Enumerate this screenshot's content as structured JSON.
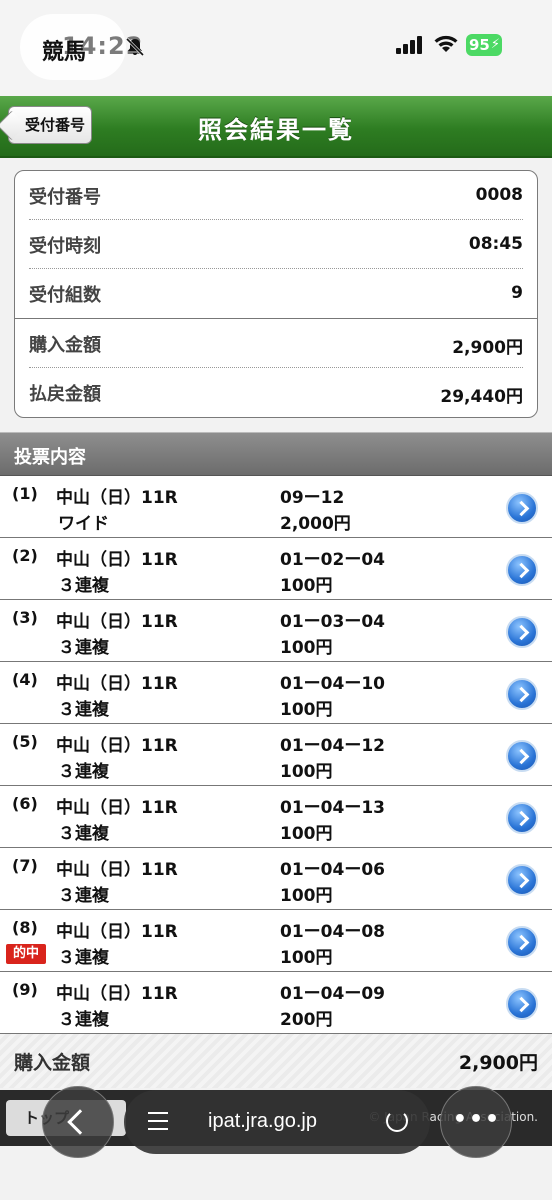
{
  "status": {
    "app_label": "競馬",
    "time": "14:22",
    "battery": "95"
  },
  "header": {
    "back_label": "受付番号",
    "title": "照会結果一覧"
  },
  "summary": [
    {
      "label": "受付番号",
      "value": "0008"
    },
    {
      "label": "受付時刻",
      "value": "08:45"
    },
    {
      "label": "受付組数",
      "value": "9"
    },
    {
      "label": "購入金額",
      "value": "2,900円"
    },
    {
      "label": "払戻金額",
      "value": "29,440円"
    }
  ],
  "section_title": "投票内容",
  "bets": [
    {
      "num": "(1)",
      "race": "中山（日）11R",
      "type": "ワイド",
      "combo": "09ー12",
      "amount": "2,000円",
      "hit": ""
    },
    {
      "num": "(2)",
      "race": "中山（日）11R",
      "type": "３連複",
      "combo": "01ー02ー04",
      "amount": "100円",
      "hit": ""
    },
    {
      "num": "(3)",
      "race": "中山（日）11R",
      "type": "３連複",
      "combo": "01ー03ー04",
      "amount": "100円",
      "hit": ""
    },
    {
      "num": "(4)",
      "race": "中山（日）11R",
      "type": "３連複",
      "combo": "01ー04ー10",
      "amount": "100円",
      "hit": ""
    },
    {
      "num": "(5)",
      "race": "中山（日）11R",
      "type": "３連複",
      "combo": "01ー04ー12",
      "amount": "100円",
      "hit": ""
    },
    {
      "num": "(6)",
      "race": "中山（日）11R",
      "type": "３連複",
      "combo": "01ー04ー13",
      "amount": "100円",
      "hit": ""
    },
    {
      "num": "(7)",
      "race": "中山（日）11R",
      "type": "３連複",
      "combo": "01ー04ー06",
      "amount": "100円",
      "hit": ""
    },
    {
      "num": "(8)",
      "race": "中山（日）11R",
      "type": "３連複",
      "combo": "01ー04ー08",
      "amount": "100円",
      "hit": "的中"
    },
    {
      "num": "(9)",
      "race": "中山（日）11R",
      "type": "３連複",
      "combo": "01ー04ー09",
      "amount": "200円",
      "hit": ""
    }
  ],
  "total": {
    "label": "購入金額",
    "value": "2,900円"
  },
  "footer": {
    "top_label": "トップ",
    "copyright": "© Japan Racing Association."
  },
  "browser": {
    "url": "ipat.jra.go.jp"
  },
  "colors": {
    "header_green": "#2e7d22",
    "hit_red": "#d9241c",
    "arrow_blue": "#2a74d6"
  }
}
